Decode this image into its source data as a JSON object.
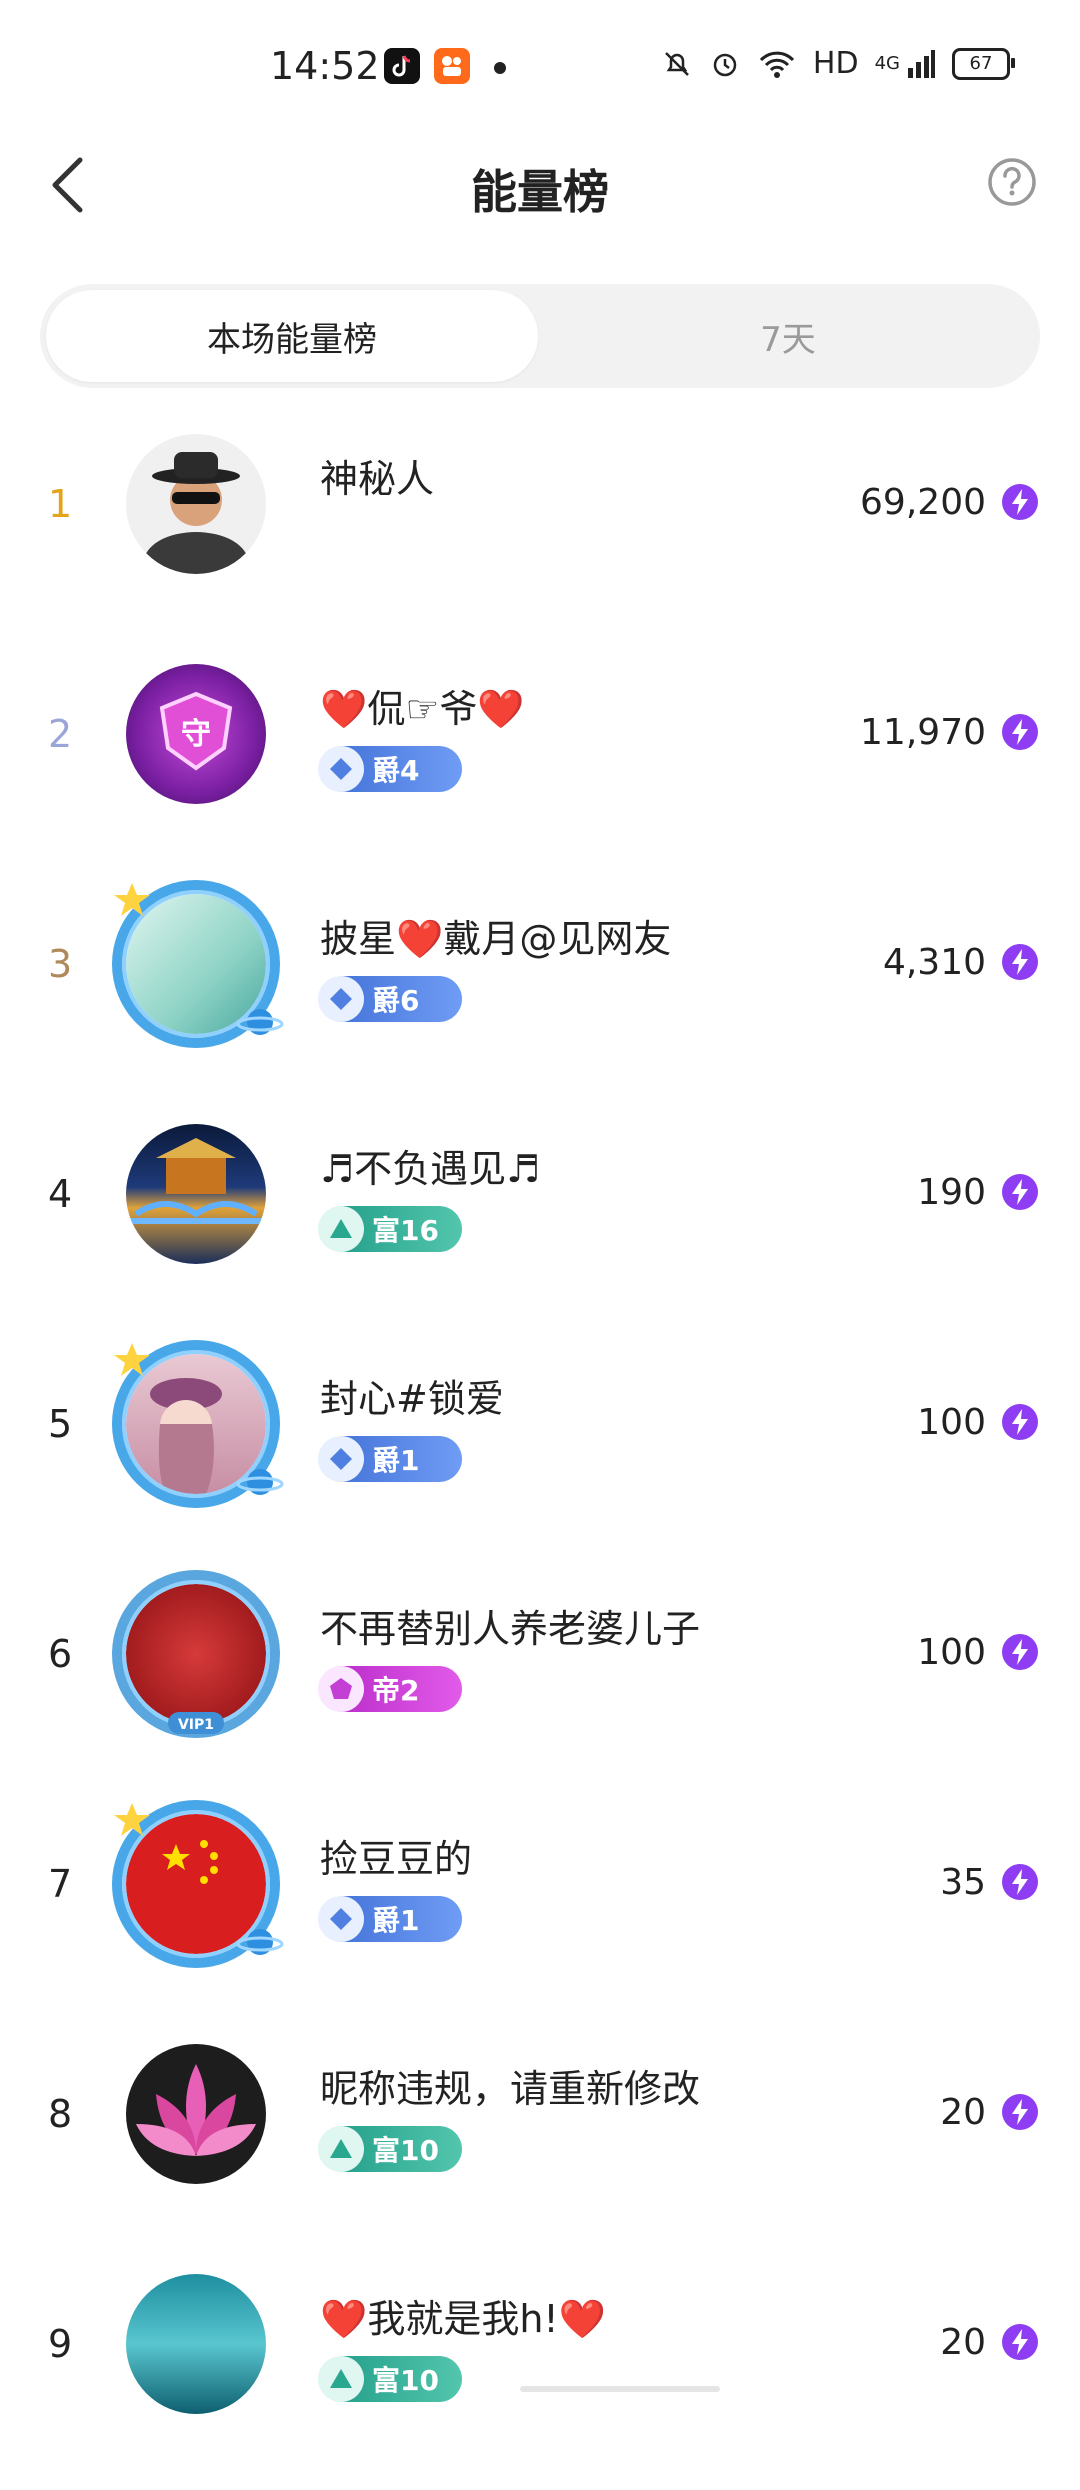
{
  "status_bar": {
    "time": "14:52",
    "right": {
      "network": "HD",
      "signal": "4G",
      "battery": "67"
    }
  },
  "header": {
    "title": "能量榜"
  },
  "tabs": [
    {
      "label": "本场能量榜",
      "active": true
    },
    {
      "label": "7天",
      "active": false
    }
  ],
  "colors": {
    "rank1": "#e2a51a",
    "rank2": "#9aa6d8",
    "rank3": "#b08a5b",
    "energy": "#8e3df2"
  },
  "ranking": [
    {
      "rank": "1",
      "name": "神秘人",
      "badge": null,
      "score": "69,200"
    },
    {
      "rank": "2",
      "name": "❤️侃☞爷❤️",
      "badge": {
        "type": "jue",
        "label": "爵4"
      },
      "score": "11,970"
    },
    {
      "rank": "3",
      "name": "披星❤️戴月@见网友",
      "badge": {
        "type": "jue",
        "label": "爵6"
      },
      "score": "4,310"
    },
    {
      "rank": "4",
      "name": "♬不负遇见♬",
      "badge": {
        "type": "fu",
        "label": "富16"
      },
      "score": "190"
    },
    {
      "rank": "5",
      "name": "封心#锁爱",
      "badge": {
        "type": "jue",
        "label": "爵1"
      },
      "score": "100"
    },
    {
      "rank": "6",
      "name": "不再替别人养老婆儿子",
      "badge": {
        "type": "di",
        "label": "帝2"
      },
      "score": "100"
    },
    {
      "rank": "7",
      "name": "捡豆豆的",
      "badge": {
        "type": "jue",
        "label": "爵1"
      },
      "score": "35"
    },
    {
      "rank": "8",
      "name": "昵称违规，请重新修改",
      "badge": {
        "type": "fu",
        "label": "富10"
      },
      "score": "20"
    },
    {
      "rank": "9",
      "name": "❤️我就是我h!❤️",
      "badge": {
        "type": "fu",
        "label": "富10"
      },
      "score": "20"
    }
  ]
}
